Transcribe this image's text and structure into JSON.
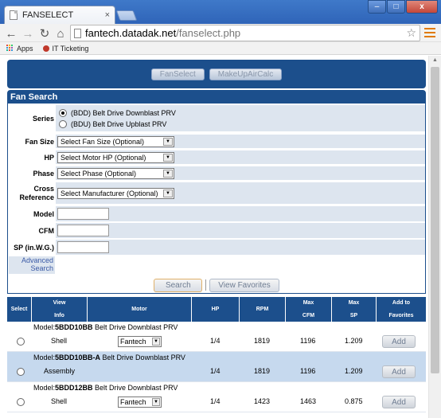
{
  "browser": {
    "tab_title": "FANSELECT",
    "tab_close": "×",
    "url_host": "fantech.datadak.net",
    "url_path": "/fanselect.php",
    "bookmarks": [
      "Apps",
      "IT Ticketing"
    ],
    "window_buttons": {
      "minimize": "–",
      "maximize": "□",
      "close": "x"
    }
  },
  "header": {
    "buttons": [
      "FanSelect",
      "MakeUpAirCalc"
    ]
  },
  "fan_search": {
    "title": "Fan Search",
    "series_label": "Series",
    "series_options": [
      {
        "label": "(BDD) Belt Drive Downblast PRV",
        "selected": true
      },
      {
        "label": "(BDU) Belt Drive Upblast PRV",
        "selected": false
      }
    ],
    "fan_size_label": "Fan Size",
    "fan_size_value": "Select Fan Size (Optional)",
    "hp_label": "HP",
    "hp_value": "Select Motor HP (Optional)",
    "phase_label": "Phase",
    "phase_value": "Select Phase (Optional)",
    "cross_ref_label_1": "Cross",
    "cross_ref_label_2": "Reference",
    "cross_ref_value": "Select Manufacturer (Optional)",
    "model_label": "Model",
    "cfm_label": "CFM",
    "sp_label": "SP (in.W.G.)",
    "advanced_1": "Advanced",
    "advanced_2": "Search",
    "search_button": "Search",
    "favorites_button": "View Favorites"
  },
  "results": {
    "headers": {
      "select": "Select",
      "view_info_1": "View",
      "view_info_2": "Info",
      "motor": "Motor",
      "hp": "HP",
      "rpm": "RPM",
      "max_cfm_1": "Max",
      "max_cfm_2": "CFM",
      "max_sp_1": "Max",
      "max_sp_2": "SP",
      "add_1": "Add to",
      "add_2": "Favorites"
    },
    "model_prefix": "Model:",
    "rows": [
      {
        "model": "5BDD10BB",
        "desc": "Belt Drive Downblast PRV",
        "view": "Shell",
        "motor": "Fantech",
        "hp": "1/4",
        "rpm": "1819",
        "max_cfm": "1196",
        "max_sp": "1.209",
        "add": "Add"
      },
      {
        "model": "5BDD10BB-A",
        "desc": "Belt Drive Downblast PRV",
        "view": "Assembly",
        "motor": "",
        "hp": "1/4",
        "rpm": "1819",
        "max_cfm": "1196",
        "max_sp": "1.209",
        "add": "Add"
      },
      {
        "model": "5BDD12BB",
        "desc": "Belt Drive Downblast PRV",
        "view": "Shell",
        "motor": "Fantech",
        "hp": "1/4",
        "rpm": "1423",
        "max_cfm": "1463",
        "max_sp": "0.875",
        "add": "Add"
      }
    ]
  }
}
